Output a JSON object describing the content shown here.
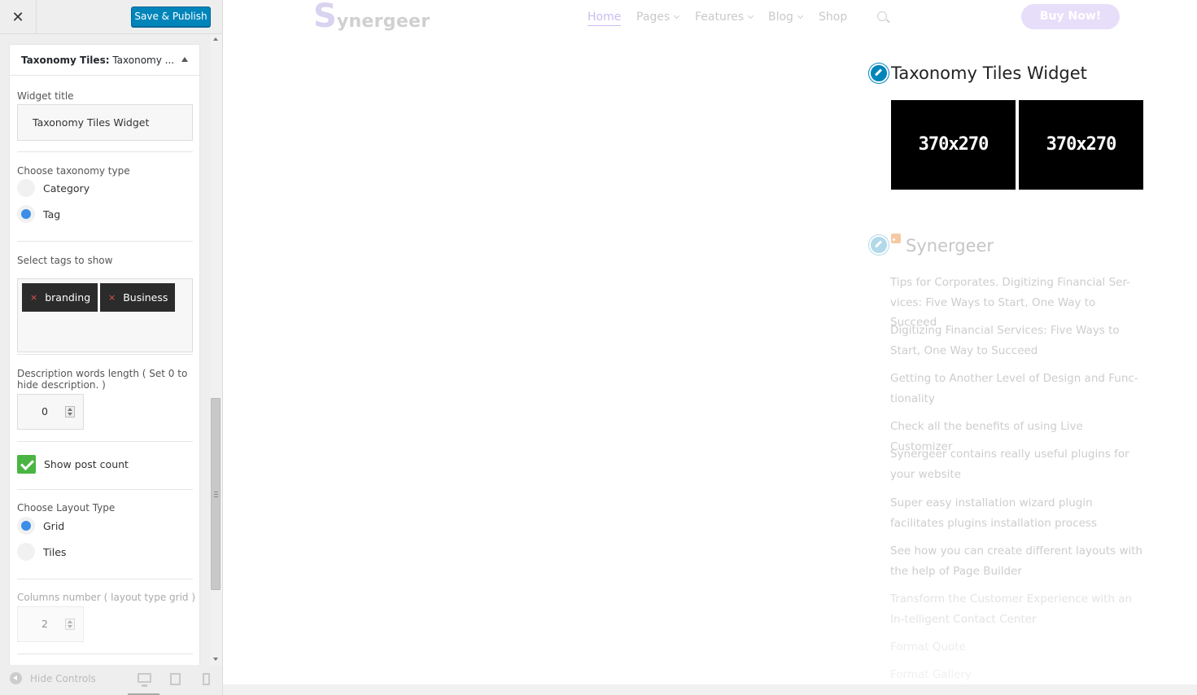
{
  "sidebar": {
    "close_glyph": "✕",
    "publish_label": "Save & Publish",
    "widget_header_bold": "Taxonomy Tiles:",
    "widget_header_rest": " Taxonomy ...",
    "widget_title_label": "Widget title",
    "widget_title_value": "Taxonomy Tiles Widget",
    "taxonomy_type_label": "Choose taxonomy type",
    "taxonomy_options": [
      {
        "label": "Category",
        "checked": false
      },
      {
        "label": "Tag",
        "checked": true
      }
    ],
    "tags_label": "Select tags to show",
    "tags": [
      {
        "label": "branding",
        "remove": "×"
      },
      {
        "label": "Business",
        "remove": "×"
      }
    ],
    "desc_length_label": "Description words length ( Set 0 to hide description. )",
    "desc_length_value": "0",
    "show_post_count_label": "Show post count",
    "show_post_count_checked": true,
    "layout_type_label": "Choose Layout Type",
    "layout_options": [
      {
        "label": "Grid",
        "checked": true
      },
      {
        "label": "Tiles",
        "checked": false
      }
    ],
    "columns_label": "Columns number ( layout type grid )",
    "columns_value": "2",
    "hide_controls_label": "Hide Controls"
  },
  "preview": {
    "logo_initial": "S",
    "logo_rest": "ynergeer",
    "nav": [
      "Home",
      "Pages",
      "Features",
      "Blog",
      "Shop"
    ],
    "buy_label": "Buy Now!",
    "tiles_widget_title": "Taxonomy Tiles Widget",
    "tiles": [
      "370x270",
      "370x270"
    ],
    "rss_title": "Synergeer",
    "posts": [
      "Tips for Corporates. Digitizing Financial Ser-vices: Five Ways to Start, One Way to Succeed",
      "Digitizing Financial Services: Five Ways to Start, One Way to Succeed",
      "Getting to Another Level of Design and Func-tionality",
      "Check all the benefits of using Live Customizer",
      "Synergeer contains really useful plugins for your website",
      "Super easy installation wizard plugin facilitates plugins installation process",
      "See how you can create different layouts with the help of Page Builder",
      "Transform the Customer Experience with an In-telligent Contact Center",
      "Format Quote",
      "Format Gallery"
    ]
  },
  "colors": {
    "publish_blue": "#0085ba",
    "radio_blue": "#3c8ee8",
    "check_green": "#4bb543",
    "tag_bg": "#2b2b2b"
  }
}
